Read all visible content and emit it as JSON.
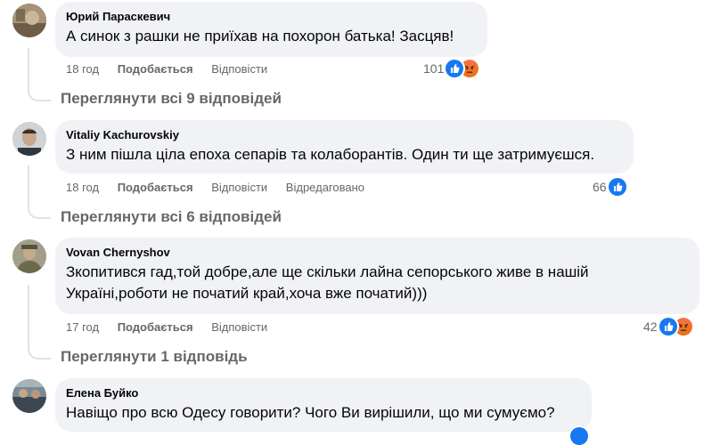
{
  "comments": [
    {
      "author": "Юрий Параскевич",
      "text_lines": [
        "А синок з рашки не приїхав на похорон батька! Засцяв!"
      ],
      "time": "18 год",
      "like_label": "Подобається",
      "reply_label": "Відповісти",
      "edited_label": "",
      "reaction_count": "101",
      "reaction_icons": [
        "like-icon",
        "angry-icon"
      ],
      "view_replies": "Переглянути всі 9 відповідей"
    },
    {
      "author": "Vitaliy Kachurovskiy",
      "text_lines": [
        "З ним пішла ціла епоха сепарів та колаборантів. Один ти ще затримуєшся."
      ],
      "time": "18 год",
      "like_label": "Подобається",
      "reply_label": "Відповісти",
      "edited_label": "Відредаговано",
      "reaction_count": "66",
      "reaction_icons": [
        "like-icon"
      ],
      "view_replies": "Переглянути всі 6 відповідей"
    },
    {
      "author": "Vovan Chernyshov",
      "text_lines": [
        "Зкопитився гад,той добре,але ще скільки лайна сепорського живе в нашій",
        "Україні,роботи не початий край,хоча вже початий)))"
      ],
      "time": "17 год",
      "like_label": "Подобається",
      "reply_label": "Відповісти",
      "edited_label": "",
      "reaction_count": "42",
      "reaction_icons": [
        "like-icon",
        "angry-icon"
      ],
      "view_replies": "Переглянути 1 відповідь"
    },
    {
      "author": "Елена Буйко",
      "text_lines": [
        "Навіщо про всю Одесу говорити? Чого Ви вирішили, що ми сумуємо?"
      ]
    }
  ],
  "colors": {
    "bubble": "#f0f2f5",
    "secondary_text": "#65676b",
    "like_blue": "#1877f2",
    "angry_orange": "#e9710f"
  }
}
